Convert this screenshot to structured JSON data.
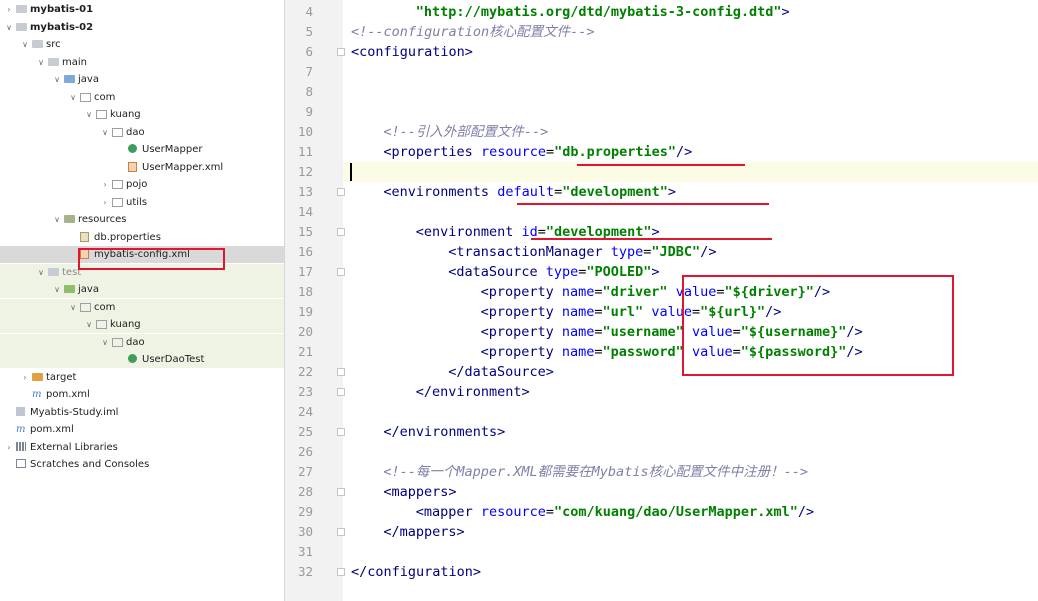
{
  "project_tree": [
    {
      "label": "mybatis-01",
      "depth": 0,
      "arrow": "right",
      "icon": "module",
      "bold": true
    },
    {
      "label": "mybatis-02",
      "depth": 0,
      "arrow": "down",
      "icon": "module",
      "bold": true
    },
    {
      "label": "src",
      "depth": 1,
      "arrow": "down",
      "icon": "folder"
    },
    {
      "label": "main",
      "depth": 2,
      "arrow": "down",
      "icon": "folder"
    },
    {
      "label": "java",
      "depth": 3,
      "arrow": "down",
      "icon": "folder-blue"
    },
    {
      "label": "com",
      "depth": 4,
      "arrow": "down",
      "icon": "package"
    },
    {
      "label": "kuang",
      "depth": 5,
      "arrow": "down",
      "icon": "package"
    },
    {
      "label": "dao",
      "depth": 6,
      "arrow": "down",
      "icon": "package"
    },
    {
      "label": "UserMapper",
      "depth": 7,
      "arrow": "",
      "icon": "class"
    },
    {
      "label": "UserMapper.xml",
      "depth": 7,
      "arrow": "",
      "icon": "xml"
    },
    {
      "label": "pojo",
      "depth": 6,
      "arrow": "right",
      "icon": "package"
    },
    {
      "label": "utils",
      "depth": 6,
      "arrow": "right",
      "icon": "package"
    },
    {
      "label": "resources",
      "depth": 3,
      "arrow": "down",
      "icon": "folder-res"
    },
    {
      "label": "db.properties",
      "depth": 4,
      "arrow": "",
      "icon": "props"
    },
    {
      "label": "mybatis-config.xml",
      "depth": 4,
      "arrow": "",
      "icon": "xml",
      "selected": true
    },
    {
      "label": "test",
      "depth": 2,
      "arrow": "down",
      "icon": "folder",
      "gray": true,
      "test": true
    },
    {
      "label": "java",
      "depth": 3,
      "arrow": "down",
      "icon": "folder-green",
      "test": true
    },
    {
      "label": "com",
      "depth": 4,
      "arrow": "down",
      "icon": "package",
      "test": true
    },
    {
      "label": "kuang",
      "depth": 5,
      "arrow": "down",
      "icon": "package",
      "test": true
    },
    {
      "label": "dao",
      "depth": 6,
      "arrow": "down",
      "icon": "package",
      "test": true
    },
    {
      "label": "UserDaoTest",
      "depth": 7,
      "arrow": "",
      "icon": "class",
      "test": true
    },
    {
      "label": "target",
      "depth": 1,
      "arrow": "right",
      "icon": "folder-orange"
    },
    {
      "label": "pom.xml",
      "depth": 1,
      "arrow": "",
      "icon": "maven"
    },
    {
      "label": "Myabtis-Study.iml",
      "depth": 0,
      "arrow": "",
      "icon": "iml"
    },
    {
      "label": "pom.xml",
      "depth": 0,
      "arrow": "",
      "icon": "maven"
    },
    {
      "label": "External Libraries",
      "depth": 0,
      "arrow": "right",
      "icon": "libraries"
    },
    {
      "label": "Scratches and Consoles",
      "depth": 0,
      "arrow": "",
      "icon": "scratches"
    }
  ],
  "icon_glyphs": {
    "maven": "m"
  },
  "code_lines": [
    {
      "num": "4",
      "indent": 8,
      "tokens": [
        {
          "t": "val",
          "s": "\"http://mybatis.org/dtd/mybatis-3-config.dtd\""
        },
        {
          "t": "tag",
          "s": ">"
        }
      ]
    },
    {
      "num": "5",
      "indent": 0,
      "tokens": [
        {
          "t": "cmt",
          "s": "<!--configuration核心配置文件-->"
        }
      ]
    },
    {
      "num": "6",
      "indent": 0,
      "fold": true,
      "tokens": [
        {
          "t": "tag",
          "s": "<configuration>"
        }
      ]
    },
    {
      "num": "7",
      "indent": 0,
      "tokens": []
    },
    {
      "num": "8",
      "indent": 0,
      "tokens": []
    },
    {
      "num": "9",
      "indent": 0,
      "tokens": []
    },
    {
      "num": "10",
      "indent": 4,
      "tokens": [
        {
          "t": "cmt",
          "s": "<!--引入外部配置文件-->"
        }
      ]
    },
    {
      "num": "11",
      "indent": 4,
      "tokens": [
        {
          "t": "tag",
          "s": "<properties "
        },
        {
          "t": "attr",
          "s": "resource"
        },
        {
          "t": "plain",
          "s": "="
        },
        {
          "t": "val",
          "s": "\"db.properties\""
        },
        {
          "t": "tag",
          "s": "/>"
        }
      ]
    },
    {
      "num": "12",
      "indent": 0,
      "current": true,
      "tokens": []
    },
    {
      "num": "13",
      "indent": 4,
      "fold": true,
      "tokens": [
        {
          "t": "tag",
          "s": "<environments "
        },
        {
          "t": "attr",
          "s": "default"
        },
        {
          "t": "plain",
          "s": "="
        },
        {
          "t": "val",
          "s": "\"development\""
        },
        {
          "t": "tag",
          "s": ">"
        }
      ]
    },
    {
      "num": "14",
      "indent": 0,
      "tokens": []
    },
    {
      "num": "15",
      "indent": 8,
      "fold": true,
      "tokens": [
        {
          "t": "tag",
          "s": "<environment "
        },
        {
          "t": "attr",
          "s": "id"
        },
        {
          "t": "plain",
          "s": "="
        },
        {
          "t": "val",
          "s": "\"development\""
        },
        {
          "t": "tag",
          "s": ">"
        }
      ]
    },
    {
      "num": "16",
      "indent": 12,
      "tokens": [
        {
          "t": "tag",
          "s": "<transactionManager "
        },
        {
          "t": "attr",
          "s": "type"
        },
        {
          "t": "plain",
          "s": "="
        },
        {
          "t": "val",
          "s": "\"JDBC\""
        },
        {
          "t": "tag",
          "s": "/>"
        }
      ]
    },
    {
      "num": "17",
      "indent": 12,
      "fold": true,
      "tokens": [
        {
          "t": "tag",
          "s": "<dataSource "
        },
        {
          "t": "attr",
          "s": "type"
        },
        {
          "t": "plain",
          "s": "="
        },
        {
          "t": "val",
          "s": "\"POOLED\""
        },
        {
          "t": "tag",
          "s": ">"
        }
      ]
    },
    {
      "num": "18",
      "indent": 16,
      "tokens": [
        {
          "t": "tag",
          "s": "<property "
        },
        {
          "t": "attr",
          "s": "name"
        },
        {
          "t": "plain",
          "s": "="
        },
        {
          "t": "val",
          "s": "\"driver\""
        },
        {
          "t": "plain",
          "s": " "
        },
        {
          "t": "attr",
          "s": "value"
        },
        {
          "t": "plain",
          "s": "="
        },
        {
          "t": "val",
          "s": "\"${driver}\""
        },
        {
          "t": "tag",
          "s": "/>"
        }
      ]
    },
    {
      "num": "19",
      "indent": 16,
      "tokens": [
        {
          "t": "tag",
          "s": "<property "
        },
        {
          "t": "attr",
          "s": "name"
        },
        {
          "t": "plain",
          "s": "="
        },
        {
          "t": "val",
          "s": "\"url\""
        },
        {
          "t": "plain",
          "s": " "
        },
        {
          "t": "attr",
          "s": "value"
        },
        {
          "t": "plain",
          "s": "="
        },
        {
          "t": "val",
          "s": "\"${url}\""
        },
        {
          "t": "tag",
          "s": "/>"
        }
      ]
    },
    {
      "num": "20",
      "indent": 16,
      "tokens": [
        {
          "t": "tag",
          "s": "<property "
        },
        {
          "t": "attr",
          "s": "name"
        },
        {
          "t": "plain",
          "s": "="
        },
        {
          "t": "val",
          "s": "\"username\""
        },
        {
          "t": "plain",
          "s": " "
        },
        {
          "t": "attr",
          "s": "value"
        },
        {
          "t": "plain",
          "s": "="
        },
        {
          "t": "val",
          "s": "\"${username}\""
        },
        {
          "t": "tag",
          "s": "/>"
        }
      ]
    },
    {
      "num": "21",
      "indent": 16,
      "tokens": [
        {
          "t": "tag",
          "s": "<property "
        },
        {
          "t": "attr",
          "s": "name"
        },
        {
          "t": "plain",
          "s": "="
        },
        {
          "t": "val",
          "s": "\"password\""
        },
        {
          "t": "plain",
          "s": " "
        },
        {
          "t": "attr",
          "s": "value"
        },
        {
          "t": "plain",
          "s": "="
        },
        {
          "t": "val",
          "s": "\"${password}\""
        },
        {
          "t": "tag",
          "s": "/>"
        }
      ]
    },
    {
      "num": "22",
      "indent": 12,
      "fold": true,
      "tokens": [
        {
          "t": "tag",
          "s": "</dataSource>"
        }
      ]
    },
    {
      "num": "23",
      "indent": 8,
      "fold": true,
      "tokens": [
        {
          "t": "tag",
          "s": "</environment>"
        }
      ]
    },
    {
      "num": "24",
      "indent": 0,
      "tokens": []
    },
    {
      "num": "25",
      "indent": 4,
      "fold": true,
      "tokens": [
        {
          "t": "tag",
          "s": "</environments>"
        }
      ]
    },
    {
      "num": "26",
      "indent": 0,
      "tokens": []
    },
    {
      "num": "27",
      "indent": 4,
      "tokens": [
        {
          "t": "cmt",
          "s": "<!--每一个Mapper.XML都需要在Mybatis核心配置文件中注册！-->"
        }
      ]
    },
    {
      "num": "28",
      "indent": 4,
      "fold": true,
      "tokens": [
        {
          "t": "tag",
          "s": "<mappers>"
        }
      ]
    },
    {
      "num": "29",
      "indent": 8,
      "tokens": [
        {
          "t": "tag",
          "s": "<mapper "
        },
        {
          "t": "attr",
          "s": "resource"
        },
        {
          "t": "plain",
          "s": "="
        },
        {
          "t": "val",
          "s": "\"com/kuang/dao/UserMapper.xml\""
        },
        {
          "t": "tag",
          "s": "/>"
        }
      ]
    },
    {
      "num": "30",
      "indent": 4,
      "fold": true,
      "tokens": [
        {
          "t": "tag",
          "s": "</mappers>"
        }
      ]
    },
    {
      "num": "31",
      "indent": 0,
      "tokens": []
    },
    {
      "num": "32",
      "indent": 0,
      "fold": true,
      "tokens": [
        {
          "t": "tag",
          "s": "</configuration>"
        }
      ]
    }
  ],
  "colors": {
    "annotation_red": "#e0152f",
    "xml_tag": "#000080",
    "xml_attr": "#0000ff",
    "xml_value": "#008000",
    "xml_comment": "#7f7fa8",
    "current_line": "#fcfbe5",
    "test_highlight": "#eef3e4",
    "selection": "#d9d9d9"
  }
}
